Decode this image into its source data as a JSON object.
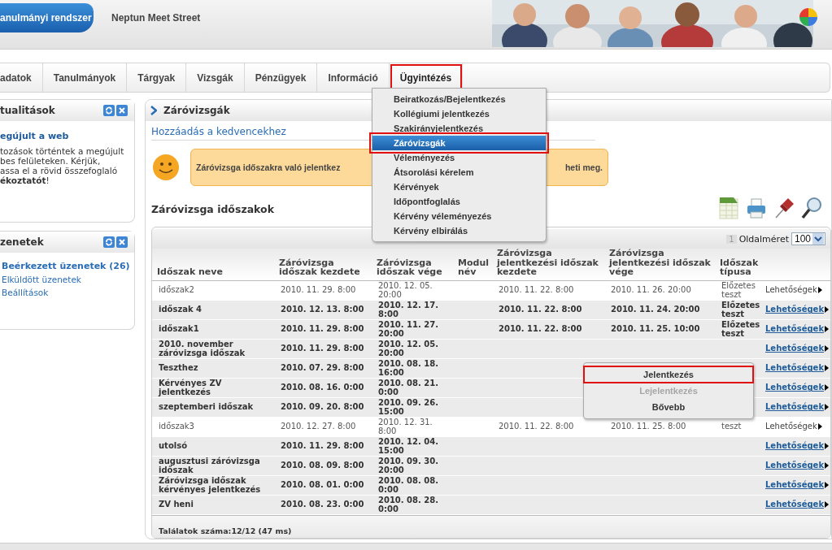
{
  "header": {
    "logo": "anulmányi rendszer",
    "site": "Neptun Meet Street"
  },
  "nav": [
    {
      "label": "adatok",
      "selected": false
    },
    {
      "label": "Tanulmányok",
      "selected": false
    },
    {
      "label": "Tárgyak",
      "selected": false
    },
    {
      "label": "Vizsgák",
      "selected": false
    },
    {
      "label": "Pénzügyek",
      "selected": false
    },
    {
      "label": "Információ",
      "selected": false
    },
    {
      "label": "Ügyintézés",
      "selected": true
    }
  ],
  "menu": [
    {
      "label": "Beiratkozás/Bejelentkezés",
      "selected": false
    },
    {
      "label": "Kollégiumi jelentkezés",
      "selected": false
    },
    {
      "label": "Szakirányjelentkezés",
      "selected": false
    },
    {
      "label": "Záróvizsgák",
      "selected": true
    },
    {
      "label": "Véleményezés",
      "selected": false
    },
    {
      "label": "Átsorolási kérelem",
      "selected": false
    },
    {
      "label": "Kérvények",
      "selected": false
    },
    {
      "label": "Időpontfoglalás",
      "selected": false
    },
    {
      "label": "Kérvény véleményezés",
      "selected": false
    },
    {
      "label": "Kérvény elbirálás",
      "selected": false
    }
  ],
  "news": {
    "title": "tualitások",
    "headline": "egújult a web",
    "lines": [
      "tozások történtek a megújult",
      "bes felületeken. Kérjük,",
      "assa el a rövid összefoglaló",
      "**ékoztatót**!"
    ]
  },
  "messages": {
    "title": "zenetek",
    "links": [
      {
        "label": "Beérkezett üzenetek (26)",
        "unread": true
      },
      {
        "label": "Elküldött üzenetek",
        "unread": false
      },
      {
        "label": "Beállítások",
        "unread": false
      }
    ]
  },
  "page": {
    "title": "Záróvizsgák",
    "favorite_link": "Hozzáadás a kedvencekhez",
    "notice": [
      "Záróvizsga időszakra való jelentkez",
      "heti meg."
    ],
    "section_title": "Záróvizsga időszakok"
  },
  "table": {
    "page_number": "1",
    "page_size_label": "Oldalméret",
    "page_size": "100",
    "columns": [
      "Időszak neve",
      "Záróvizsga időszak kezdete",
      "Záróvizsga időszak vége",
      "Modul név",
      "Záróvizsga jelentkezési időszak kezdete",
      "Záróvizsga jelentkezési időszak vége",
      "Időszak típusa"
    ],
    "rows": [
      {
        "emphasized": false,
        "name": "időszak2",
        "start": "2010. 11. 29. 8:00",
        "end": "2010. 12. 05. 20:00",
        "reg_start": "2010. 11. 22. 8:00",
        "reg_end": "2010. 11. 26. 20:00",
        "type": "Előzetes teszt",
        "action": "Lehetőségek"
      },
      {
        "emphasized": true,
        "name": "időszak 4",
        "start": "2010. 12. 13. 8:00",
        "end": "2010. 12. 17. 8:00",
        "reg_start": "2010. 11. 22. 8:00",
        "reg_end": "2010. 11. 24. 20:00",
        "type": "Előzetes teszt",
        "action": "Lehetőségek"
      },
      {
        "emphasized": true,
        "name": "időszak1",
        "start": "2010. 11. 29. 8:00",
        "end": "2010. 11. 27. 20:00",
        "reg_start": "2010. 11. 22. 8:00",
        "reg_end": "2010. 11. 25. 10:00",
        "type": "Előzetes teszt",
        "action": "Lehetőségek"
      },
      {
        "emphasized": true,
        "name": "2010. november záróvizsga időszak",
        "start": "2010. 11. 29. 8:00",
        "end": "2010. 12. 05. 20:00",
        "action": "Lehetőségek"
      },
      {
        "emphasized": true,
        "name": "Teszthez",
        "start": "2010. 07. 29. 8:00",
        "end": "2010. 08. 18. 16:00",
        "action": "Lehetőségek"
      },
      {
        "emphasized": true,
        "name": "Kérvényes ZV jelentkezés",
        "start": "2010. 08. 16. 0:00",
        "end": "2010. 08. 21. 0:00",
        "action": "Lehetőségek"
      },
      {
        "emphasized": true,
        "name": "szeptemberi időszak",
        "start": "2010. 09. 20. 8:00",
        "end": "2010. 09. 26. 15:00",
        "action": "Lehetőségek"
      },
      {
        "emphasized": false,
        "name": "időszak3",
        "start": "2010. 12. 27. 8:00",
        "end": "2010. 12. 31. 8:00",
        "reg_start": "2010. 11. 22. 8:00",
        "reg_end": "2010. 11. 25. 8:00",
        "type": "teszt",
        "action": "Lehetőségek"
      },
      {
        "emphasized": true,
        "name": "utolsó",
        "start": "2010. 11. 29. 8:00",
        "end": "2010. 12. 04. 15:00",
        "action": "Lehetőségek"
      },
      {
        "emphasized": true,
        "name": "augusztusi záróvizsga időszak",
        "start": "2010. 08. 09. 8:00",
        "end": "2010. 09. 30. 20:00",
        "action": "Lehetőségek"
      },
      {
        "emphasized": true,
        "name": "Záróvizsga időszak kérvényes jelentkezés",
        "start": "2010. 08. 01. 0:00",
        "end": "2010. 08. 08. 0:00",
        "action": "Lehetőségek"
      },
      {
        "emphasized": true,
        "name": "ZV heni",
        "start": "2010. 08. 23. 0:00",
        "end": "2010. 08. 28. 0:00",
        "action": "Lehetőségek"
      }
    ],
    "footer": "Találatok száma:12/12 (47 ms)"
  },
  "context_menu": [
    {
      "label": "Jelentkezés",
      "disabled": false,
      "highlighted": true
    },
    {
      "label": "Lejelentkezés",
      "disabled": true,
      "highlighted": false
    },
    {
      "label": "Bővebb",
      "disabled": false,
      "highlighted": false
    }
  ]
}
